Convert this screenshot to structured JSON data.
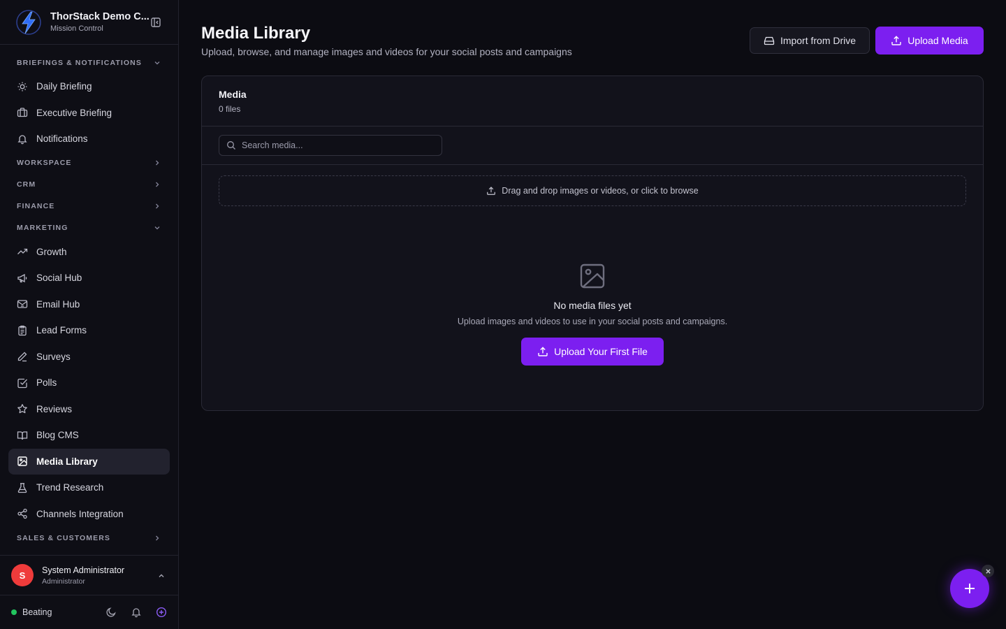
{
  "brand": {
    "title": "ThorStack Demo C...",
    "subtitle": "Mission Control"
  },
  "sidebar": {
    "briefings": {
      "label": "BRIEFINGS & NOTIFICATIONS",
      "items": [
        {
          "label": "Daily Briefing",
          "icon": "sun-icon"
        },
        {
          "label": "Executive Briefing",
          "icon": "briefcase-icon"
        },
        {
          "label": "Notifications",
          "icon": "bell-icon"
        }
      ]
    },
    "workspace": {
      "label": "WORKSPACE"
    },
    "crm": {
      "label": "CRM"
    },
    "finance": {
      "label": "FINANCE"
    },
    "marketing": {
      "label": "MARKETING",
      "items": [
        {
          "label": "Growth",
          "icon": "trending-up-icon"
        },
        {
          "label": "Social Hub",
          "icon": "megaphone-icon"
        },
        {
          "label": "Email Hub",
          "icon": "mail-icon"
        },
        {
          "label": "Lead Forms",
          "icon": "clipboard-icon"
        },
        {
          "label": "Surveys",
          "icon": "pen-icon"
        },
        {
          "label": "Polls",
          "icon": "check-square-icon"
        },
        {
          "label": "Reviews",
          "icon": "star-icon"
        },
        {
          "label": "Blog CMS",
          "icon": "book-icon"
        },
        {
          "label": "Media Library",
          "icon": "image-icon",
          "active": true
        },
        {
          "label": "Trend Research",
          "icon": "flask-icon"
        },
        {
          "label": "Channels Integration",
          "icon": "share-icon"
        }
      ]
    },
    "sales": {
      "label": "SALES & CUSTOMERS"
    }
  },
  "user": {
    "initial": "S",
    "name": "System Administrator",
    "role": "Administrator"
  },
  "footer": {
    "status": "Beating",
    "status_color": "#22c55e"
  },
  "page": {
    "title": "Media Library",
    "subtitle": "Upload, browse, and manage images and videos for your social posts and campaigns",
    "import_label": "Import from Drive",
    "upload_label": "Upload Media"
  },
  "card": {
    "title": "Media",
    "count": "0 files",
    "search_placeholder": "Search media...",
    "dropzone_text": "Drag and drop images or videos, or click to browse",
    "empty_title": "No media files yet",
    "empty_sub": "Upload images and videos to use in your social posts and campaigns.",
    "empty_button": "Upload Your First File"
  },
  "colors": {
    "accent": "#7c1ff0",
    "background": "#0c0c12",
    "danger": "#ef3b3b"
  }
}
